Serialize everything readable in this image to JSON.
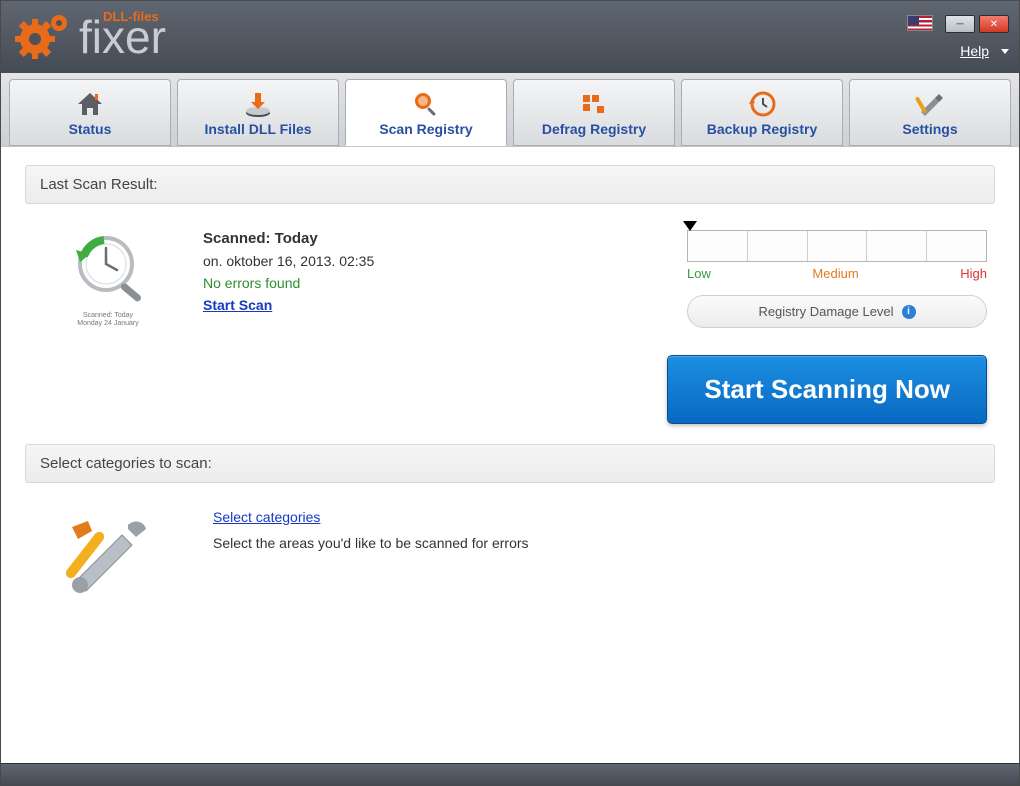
{
  "app": {
    "brand_main": "fixer",
    "brand_sub": "DLL-files",
    "help_label": "Help"
  },
  "tabs": [
    {
      "id": "status",
      "label": "Status"
    },
    {
      "id": "install-dll",
      "label": "Install DLL Files"
    },
    {
      "id": "scan-registry",
      "label": "Scan Registry"
    },
    {
      "id": "defrag-registry",
      "label": "Defrag Registry"
    },
    {
      "id": "backup-registry",
      "label": "Backup Registry"
    },
    {
      "id": "settings",
      "label": "Settings"
    }
  ],
  "active_tab": "scan-registry",
  "section1": {
    "header": "Last Scan Result:",
    "scan_icon_caption_line1": "Scanned: Today",
    "scan_icon_caption_line2": "Monday 24 January",
    "scanned_heading": "Scanned: Today",
    "scan_datetime": "on. oktober 16, 2013. 02:35",
    "status_text": "No errors found",
    "start_scan_link": "Start Scan",
    "gauge": {
      "low": "Low",
      "medium": "Medium",
      "high": "High",
      "pill": "Registry Damage Level"
    },
    "main_button": "Start Scanning Now"
  },
  "section2": {
    "header": "Select categories to scan:",
    "link": "Select categories",
    "desc": "Select the areas you'd like to be scanned for errors"
  },
  "colors": {
    "accent": "#e96b1a",
    "link": "#1638c4",
    "success": "#2e8f2e"
  }
}
